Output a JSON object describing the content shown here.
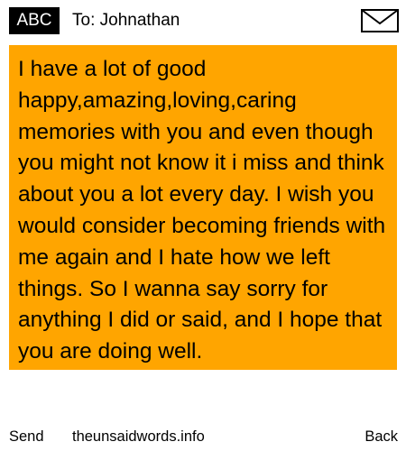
{
  "header": {
    "badge_label": "ABC",
    "recipient": "To: Johnathan",
    "envelope_icon": "envelope-icon"
  },
  "message": {
    "background_color": "#ffa500",
    "text": "I have a lot of good happy,amazing,loving,caring memories with you and even though you might not know it i miss and think about you a lot every day. I wish you would consider becoming friends with me again and I hate how we left things. So I wanna say sorry for anything I did or said, and I hope that you are doing well."
  },
  "footer": {
    "send_label": "Send",
    "site_label": "theunsaidwords.info",
    "back_label": "Back"
  }
}
